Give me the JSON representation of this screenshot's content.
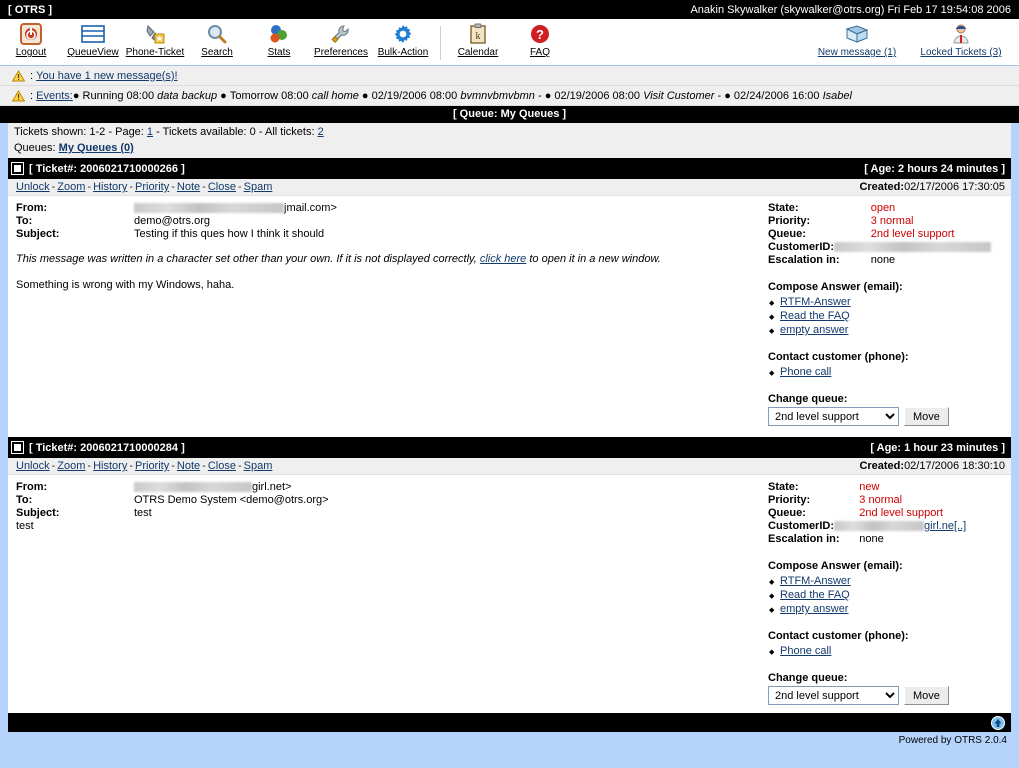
{
  "app": {
    "title": "[ OTRS ]",
    "user_line": "Anakin Skywalker (skywalker@otrs.org) Fri Feb 17 19:54:08 2006",
    "powered_by": "Powered by OTRS 2.0.4"
  },
  "toolbar": {
    "items": [
      {
        "label": "Logout",
        "icon": "power-icon"
      },
      {
        "label": "QueueView",
        "icon": "queueview-icon"
      },
      {
        "label": "Phone-Ticket",
        "icon": "phone-ticket-icon"
      },
      {
        "label": "Search",
        "icon": "search-icon"
      },
      {
        "label": "Stats",
        "icon": "stats-icon"
      },
      {
        "label": "Preferences",
        "icon": "wrench-icon"
      },
      {
        "label": "Bulk-Action",
        "icon": "gear-icon"
      }
    ],
    "secondary": [
      {
        "label": "Calendar",
        "icon": "calendar-icon"
      },
      {
        "label": "FAQ",
        "icon": "faq-icon"
      }
    ],
    "right": [
      {
        "label": "New message (1)",
        "icon": "new-message-icon"
      },
      {
        "label": "Locked Tickets (3)",
        "icon": "locked-tickets-icon"
      }
    ]
  },
  "notices": {
    "message": {
      "prefix": ":",
      "link": "You have 1 new message(s)!"
    },
    "events": {
      "prefix": ":",
      "link": "Events:",
      "items": [
        {
          "when": "Running 08:00",
          "what": "data backup",
          "trail": ""
        },
        {
          "when": "Tomorrow 08:00",
          "what": "call home",
          "trail": ""
        },
        {
          "when": "02/19/2006 08:00",
          "what": "bvmnvbmvbmn",
          "trail": " - "
        },
        {
          "when": "02/19/2006 08:00",
          "what": "Visit Customer",
          "trail": " - "
        },
        {
          "when": "02/24/2006 16:00",
          "what": "Isabel",
          "trail": ""
        }
      ]
    }
  },
  "queue_header": "[ Queue: My Queues ]",
  "info": {
    "tickets_shown_label": "Tickets shown:",
    "tickets_shown_value": "1-2",
    "page_label": "Page:",
    "page_value": "1",
    "available_label": "Tickets available:",
    "available_value": "0",
    "all_label": "All tickets:",
    "all_value": "2",
    "queues_label": "Queues:",
    "queues_value": "My Queues (0)"
  },
  "ticket_actions": [
    "Unlock",
    "Zoom",
    "History",
    "Priority",
    "Note",
    "Close",
    "Spam"
  ],
  "labels": {
    "from": "From:",
    "to": "To:",
    "subject": "Subject:",
    "state": "State:",
    "priority": "Priority:",
    "queue": "Queue:",
    "customer_id": "CustomerID:",
    "escalation": "Escalation in:",
    "created": "Created:",
    "compose_answer": "Compose Answer (email):",
    "contact_customer": "Contact customer (phone):",
    "change_queue": "Change queue:",
    "move_button": "Move"
  },
  "answer_links": [
    "RTFM-Answer",
    "Read the FAQ",
    "empty answer"
  ],
  "phone_links": [
    "Phone call"
  ],
  "queue_options": [
    "2nd level support"
  ],
  "tickets": [
    {
      "number": "[ Ticket#: 2006021710000266 ]",
      "age": "[ Age: 2 hours 24 minutes ]",
      "created": "02/17/2006 17:30:05",
      "from_redacted_width": 150,
      "from_tail": "jmail.com>",
      "to": "demo@otrs.org",
      "subject": "Testing if this ques how I think it should",
      "charset_note_pre": "This message was written in a character set other than your own. If it is not displayed correctly, ",
      "charset_note_link": "click here",
      "charset_note_post": " to open it in a new window.",
      "body": "Something is wrong with my Windows, haha.",
      "state": "open",
      "priority": "3 normal",
      "queue": "2nd level support",
      "customer_id_redacted_width": 157,
      "customer_id_tail": "",
      "escalation": "none",
      "selected_queue": "2nd level support"
    },
    {
      "number": "[ Ticket#: 2006021710000284 ]",
      "age": "[ Age: 1 hour 23 minutes ]",
      "created": "02/17/2006 18:30:10",
      "from_redacted_width": 118,
      "from_tail": "girl.net>",
      "to": "OTRS Demo System <demo@otrs.org>",
      "subject": "test",
      "charset_note_pre": "",
      "charset_note_link": "",
      "charset_note_post": "",
      "body": "test",
      "state": "new",
      "priority": "3 normal",
      "queue": "2nd level support",
      "customer_id_redacted_width": 90,
      "customer_id_tail": "girl.ne[..]",
      "escalation": "none",
      "selected_queue": "2nd level support"
    }
  ],
  "colors": {
    "accent_blue": "#b6d4fb",
    "value_red": "#cc0000",
    "link_blue": "#123a6b",
    "header_black": "#000000"
  },
  "footer": {
    "top_icon": "scroll-to-top-icon"
  }
}
